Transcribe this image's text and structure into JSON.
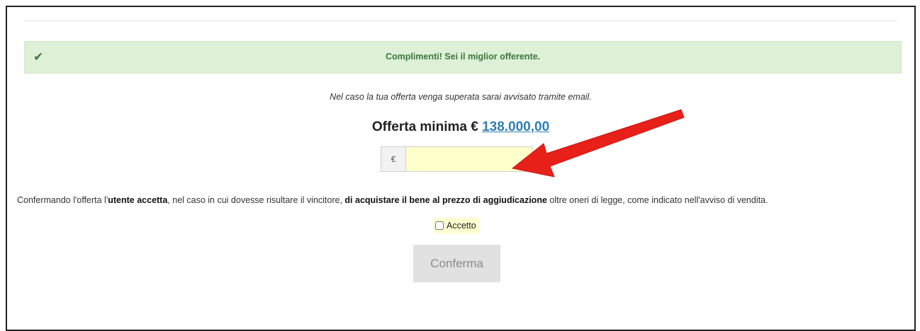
{
  "alert": {
    "icon": "check-icon",
    "message": "Complimenti! Sei il miglior offerente."
  },
  "notice": "Nel caso la tua offerta venga superata sarai avvisato tramite email.",
  "minimum_offer": {
    "label": "Offerta minima €",
    "amount": "138.000,00"
  },
  "bid_input": {
    "currency_symbol": "€",
    "value": "",
    "placeholder": ""
  },
  "terms": {
    "part1": "Confermando l'offerta l'",
    "bold1": "utente accetta",
    "part2": ", nel caso in cui dovesse risultare il vincitore, ",
    "bold2": "di acquistare il bene al prezzo di aggiudicazione",
    "part3": " oltre oneri di legge, come indicato nell'avviso di vendita."
  },
  "accept_checkbox": {
    "label": "Accetto",
    "checked": false
  },
  "confirm_button": {
    "label": "Conferma"
  },
  "colors": {
    "alert_bg": "#dff0d8",
    "alert_text": "#3c763d",
    "link": "#2f7fb3",
    "input_bg": "#ffffcc",
    "arrow": "#e8201a"
  }
}
